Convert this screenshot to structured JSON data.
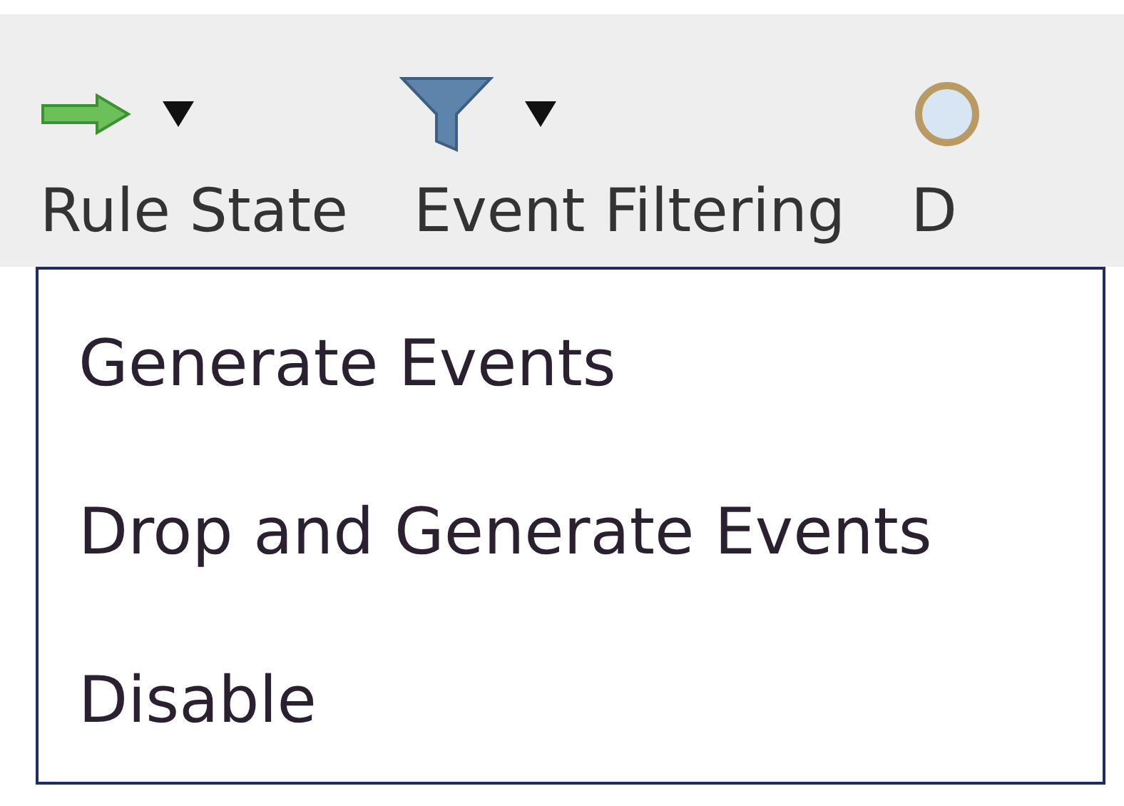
{
  "toolbar": {
    "items": [
      {
        "label": "Rule State",
        "kind": "arrow",
        "dropdown": true
      },
      {
        "label": "Event Filtering",
        "kind": "filter",
        "dropdown": true
      },
      {
        "label": "D",
        "kind": "lens"
      }
    ]
  },
  "menu": {
    "items": [
      {
        "label": "Generate Events"
      },
      {
        "label": "Drop and Generate Events"
      },
      {
        "label": "Disable"
      }
    ]
  }
}
